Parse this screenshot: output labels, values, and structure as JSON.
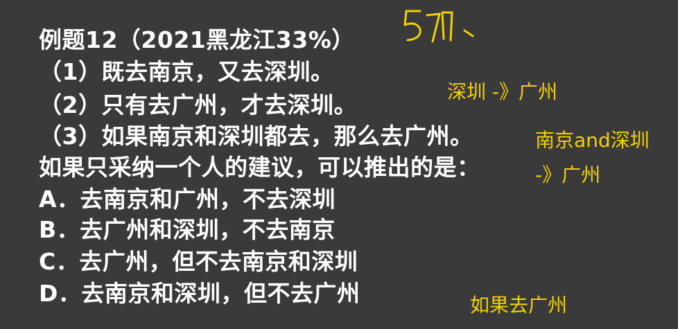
{
  "question": {
    "title": "例题12（2021黑龙江33%）",
    "statements": [
      "（1）既去南京，又去深圳。",
      "（2）只有去广州，才去深圳。",
      "（3）如果南京和深圳都去，那么去广州。"
    ],
    "prompt": "如果只采纳一个人的建议，可以推出的是：",
    "options": [
      "A．去南京和广州，不去深圳",
      "B．去广州和深圳，不去南京",
      "C．去广州，但不去南京和深圳",
      "D．去南京和深圳，但不去广州"
    ]
  },
  "annotations": {
    "note_1": "深圳 -》广州",
    "note_2_line1": "南京and深圳",
    "note_2_line2": "-》广州",
    "note_3": "如果去广州"
  },
  "colors": {
    "background": "#3a3a3a",
    "text": "#ffffff",
    "annotation": "#f2d100"
  }
}
